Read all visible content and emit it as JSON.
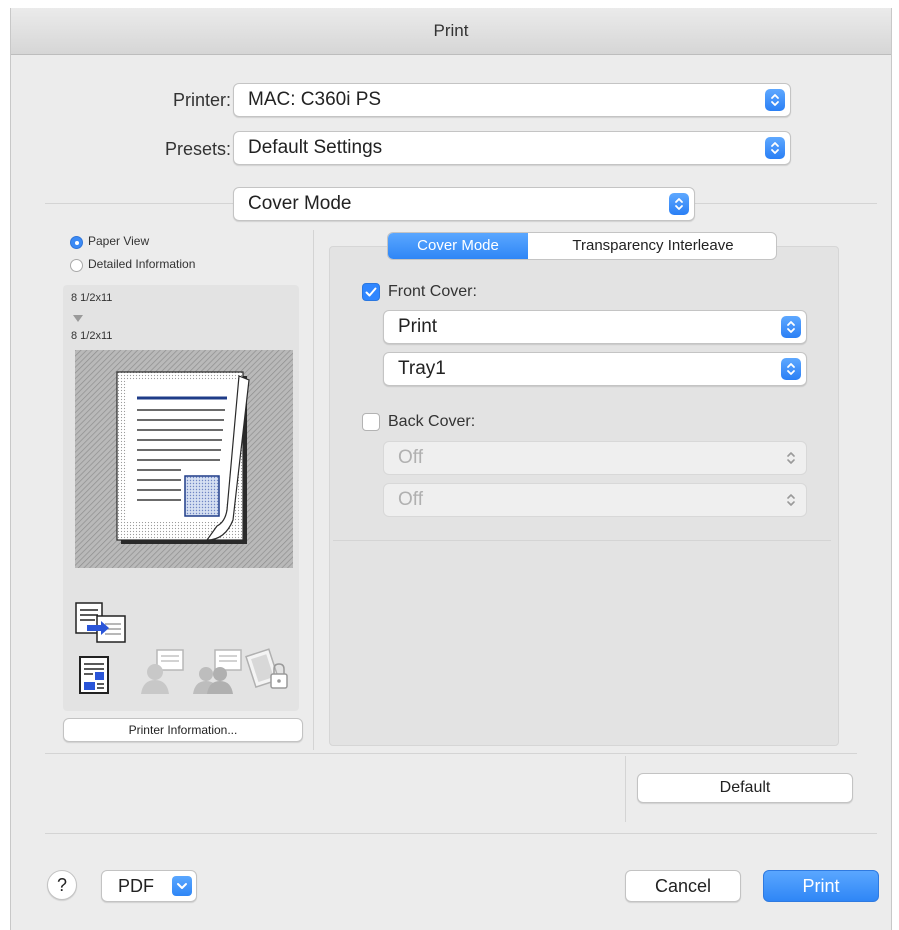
{
  "window": {
    "title": "Print"
  },
  "printer": {
    "label": "Printer:",
    "value": "MAC: C360i PS"
  },
  "presets": {
    "label": "Presets:",
    "value": "Default Settings"
  },
  "section": {
    "value": "Cover Mode"
  },
  "preview": {
    "options": [
      {
        "label": "Paper View",
        "selected": true
      },
      {
        "label": "Detailed Information",
        "selected": false
      }
    ],
    "size_top": "8 1/2x11",
    "size_bottom": "8 1/2x11",
    "icons": [
      "document-transfer-icon",
      "document-layout-icon",
      "user-message-icon",
      "users-message-icon",
      "secure-print-icon"
    ],
    "printer_info_button": "Printer Information..."
  },
  "tabs": [
    {
      "label": "Cover Mode",
      "active": true
    },
    {
      "label": "Transparency Interleave",
      "active": false
    }
  ],
  "front_cover": {
    "label": "Front Cover:",
    "checked": true,
    "mode": "Print",
    "tray": "Tray1"
  },
  "back_cover": {
    "label": "Back Cover:",
    "checked": false,
    "mode": "Off",
    "tray": "Off"
  },
  "default_button": "Default",
  "footer": {
    "help": "?",
    "pdf": "PDF",
    "cancel": "Cancel",
    "print": "Print"
  },
  "colors": {
    "accent": "#2f86f6",
    "window_bg": "#ececec",
    "navy_line": "#1f3c88"
  }
}
